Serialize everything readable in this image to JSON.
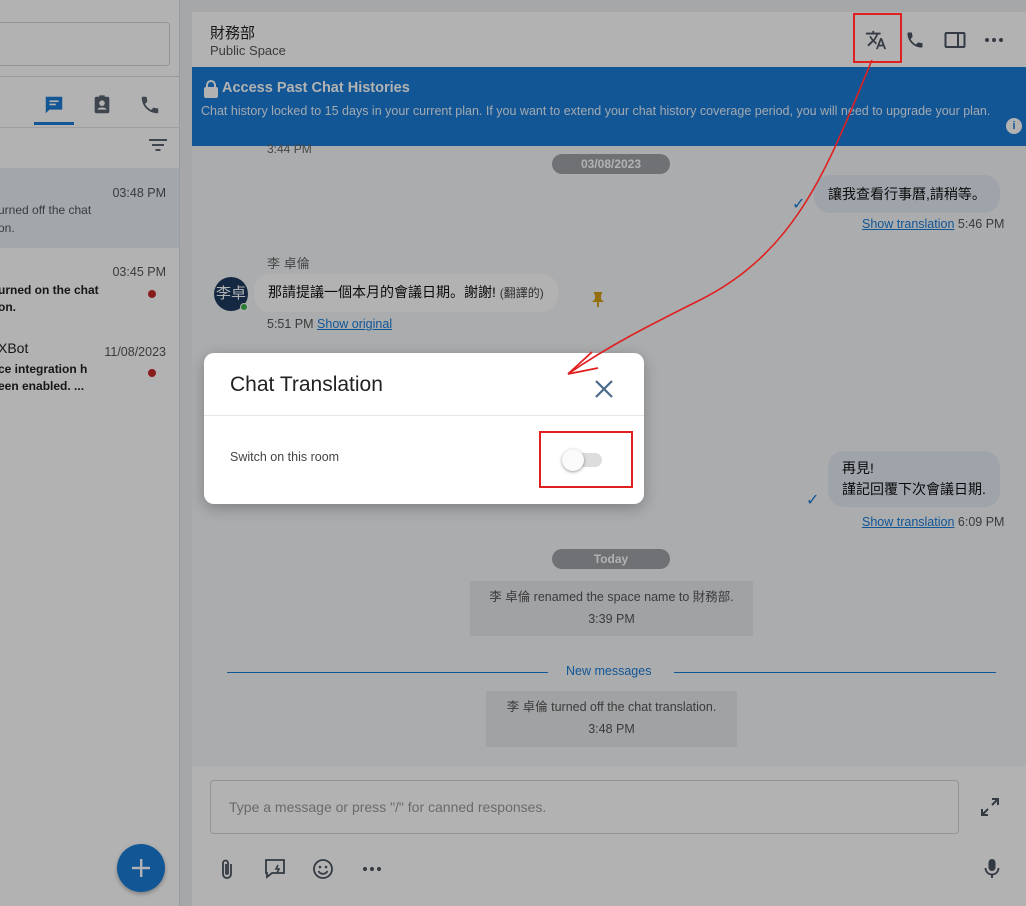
{
  "sidebar": {
    "tabs": [
      {
        "name": "chats",
        "icon": "chat-icon",
        "active": true
      },
      {
        "name": "contacts",
        "icon": "contact-card-icon",
        "active": false
      },
      {
        "name": "calls",
        "icon": "phone-icon",
        "active": false
      }
    ],
    "conversations": [
      {
        "time": "03:48 PM",
        "line1": "urned off the chat",
        "line2": "on.",
        "unread": false
      },
      {
        "time": "03:45 PM",
        "line1": "urned on the chat",
        "line2": "on.",
        "unread": true
      },
      {
        "title": "XBot",
        "time": "11/08/2023",
        "line1": "ce integration h",
        "line2": "een enabled. ...",
        "unread": true
      }
    ]
  },
  "header": {
    "space_name": "財務部",
    "space_type": "Public Space"
  },
  "banner": {
    "title": "Access Past Chat Histories",
    "text": "Chat history locked to 15 days in your current plan. If you want to extend your chat history coverage period, you will need to upgrade your plan.",
    "info": "i"
  },
  "chat": {
    "top_time": "3:44 PM",
    "date1": "03/08/2023",
    "msg1": {
      "text": "讓我查看行事曆,請稍等。",
      "link": "Show translation",
      "time": "5:46 PM"
    },
    "msg2": {
      "sender": "李 卓倫",
      "avatar": "李卓",
      "text": "那請提議一個本月的會議日期。謝謝!",
      "tag": "(翻譯的)",
      "time": "5:51 PM",
      "link": "Show original"
    },
    "msg3": {
      "line1": "再見!",
      "line2": "謹記回覆下次會議日期.",
      "link": "Show translation",
      "time": "6:09 PM"
    },
    "date2": "Today",
    "sys1": {
      "text": "李 卓倫 renamed the space name to 財務部.",
      "time": "3:39 PM"
    },
    "new_messages": "New messages",
    "sys2": {
      "text": "李 卓倫 turned off the chat translation.",
      "time": "3:48 PM"
    }
  },
  "composer": {
    "placeholder": "Type a message or press \"/\" for canned responses."
  },
  "dialog": {
    "title": "Chat Translation",
    "label": "Switch on this room",
    "toggle_on": false
  },
  "colors": {
    "accent": "#1a7cd7",
    "annotation": "#e02020",
    "unread_dot": "#c62828"
  }
}
